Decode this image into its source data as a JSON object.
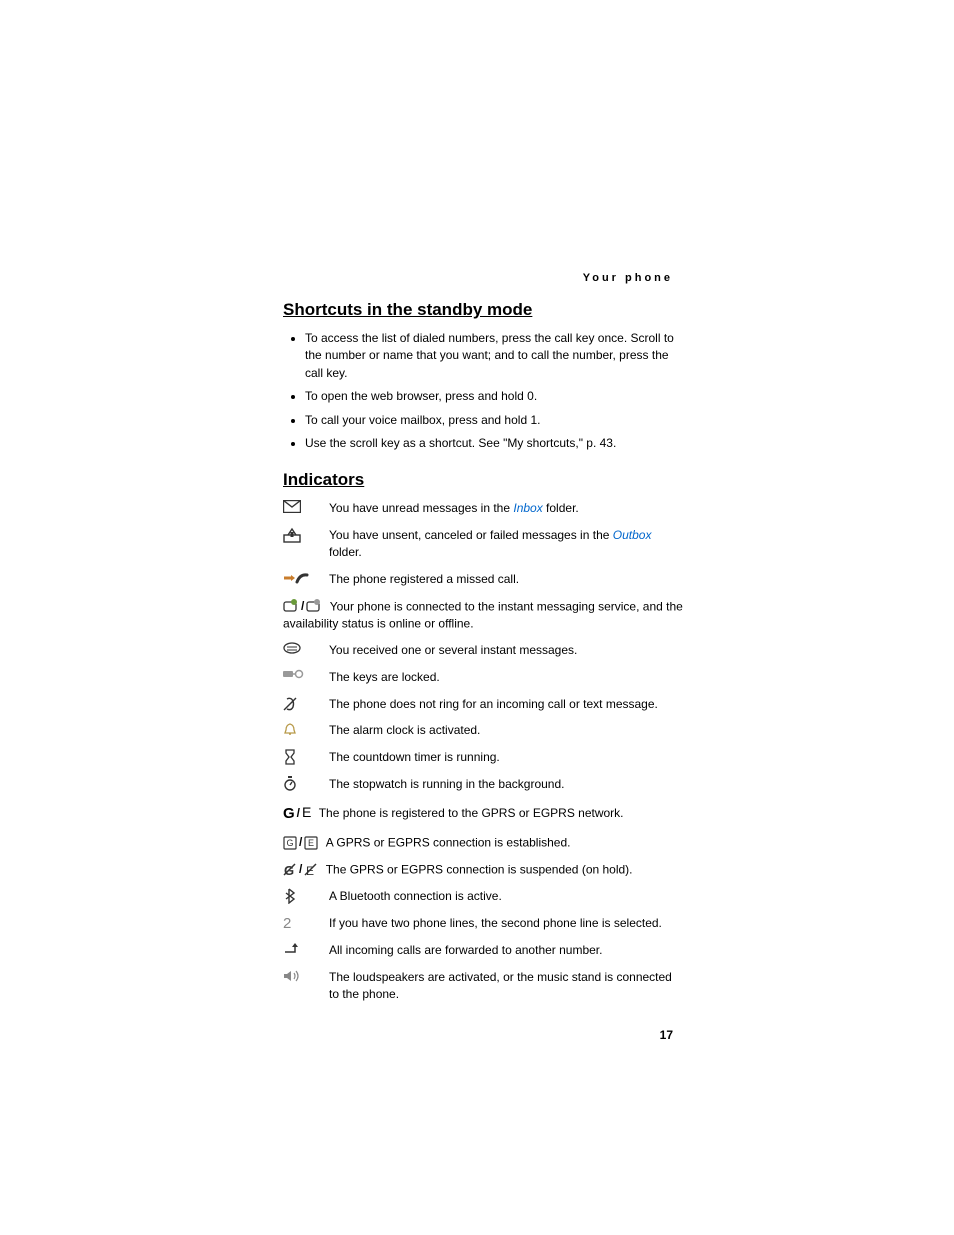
{
  "header": "Your phone",
  "page_number": "17",
  "section_shortcuts": {
    "title": "Shortcuts in the standby mode",
    "items": [
      "To access the list of dialed numbers, press the call key once. Scroll to the number or name that you want; and to call the number, press the call key.",
      "To open the web browser, press and hold 0.",
      "To call your voice mailbox, press and hold 1.",
      "Use the scroll key as a shortcut. See \"My shortcuts,\" p. 43."
    ]
  },
  "section_indicators": {
    "title": "Indicators",
    "rows": [
      {
        "icon": "envelope-icon",
        "pre": "You have unread messages in the ",
        "link": "Inbox",
        "post": " folder."
      },
      {
        "icon": "outbox-icon",
        "pre": "You have unsent, canceled or failed messages in the ",
        "link": "Outbox",
        "post": " folder."
      },
      {
        "icon": "missed-call-icon",
        "text": "The phone registered a missed call."
      },
      {
        "icon": "im-pair-icon",
        "text": "Your phone is connected to the instant messaging service, and the availability status is online or offline."
      },
      {
        "icon": "im-received-icon",
        "text": "You received one or several instant messages."
      },
      {
        "icon": "keylock-icon",
        "text": "The keys are locked."
      },
      {
        "icon": "silent-icon",
        "text": "The phone does not ring for an incoming call or text message."
      },
      {
        "icon": "alarm-icon",
        "text": "The alarm clock is activated."
      },
      {
        "icon": "timer-icon",
        "text": "The countdown timer is running."
      },
      {
        "icon": "stopwatch-icon",
        "text": "The stopwatch is running in the background."
      },
      {
        "icon": "gprs-pair-icon",
        "text": "The phone is registered to the GPRS or EGPRS network."
      },
      {
        "icon": "gprs-conn-pair-icon",
        "text": "A GPRS or EGPRS connection is established."
      },
      {
        "icon": "gprs-hold-pair-icon",
        "text": "The GPRS or EGPRS connection is suspended (on hold)."
      },
      {
        "icon": "bluetooth-icon",
        "text": "A Bluetooth connection is active."
      },
      {
        "icon": "line2-icon",
        "text": "If you have two phone lines, the second phone line is selected."
      },
      {
        "icon": "forward-icon",
        "text": "All incoming calls are forwarded to another number."
      },
      {
        "icon": "loudspeaker-icon",
        "text": "The loudspeakers are activated, or the music stand is connected to the phone."
      }
    ]
  }
}
